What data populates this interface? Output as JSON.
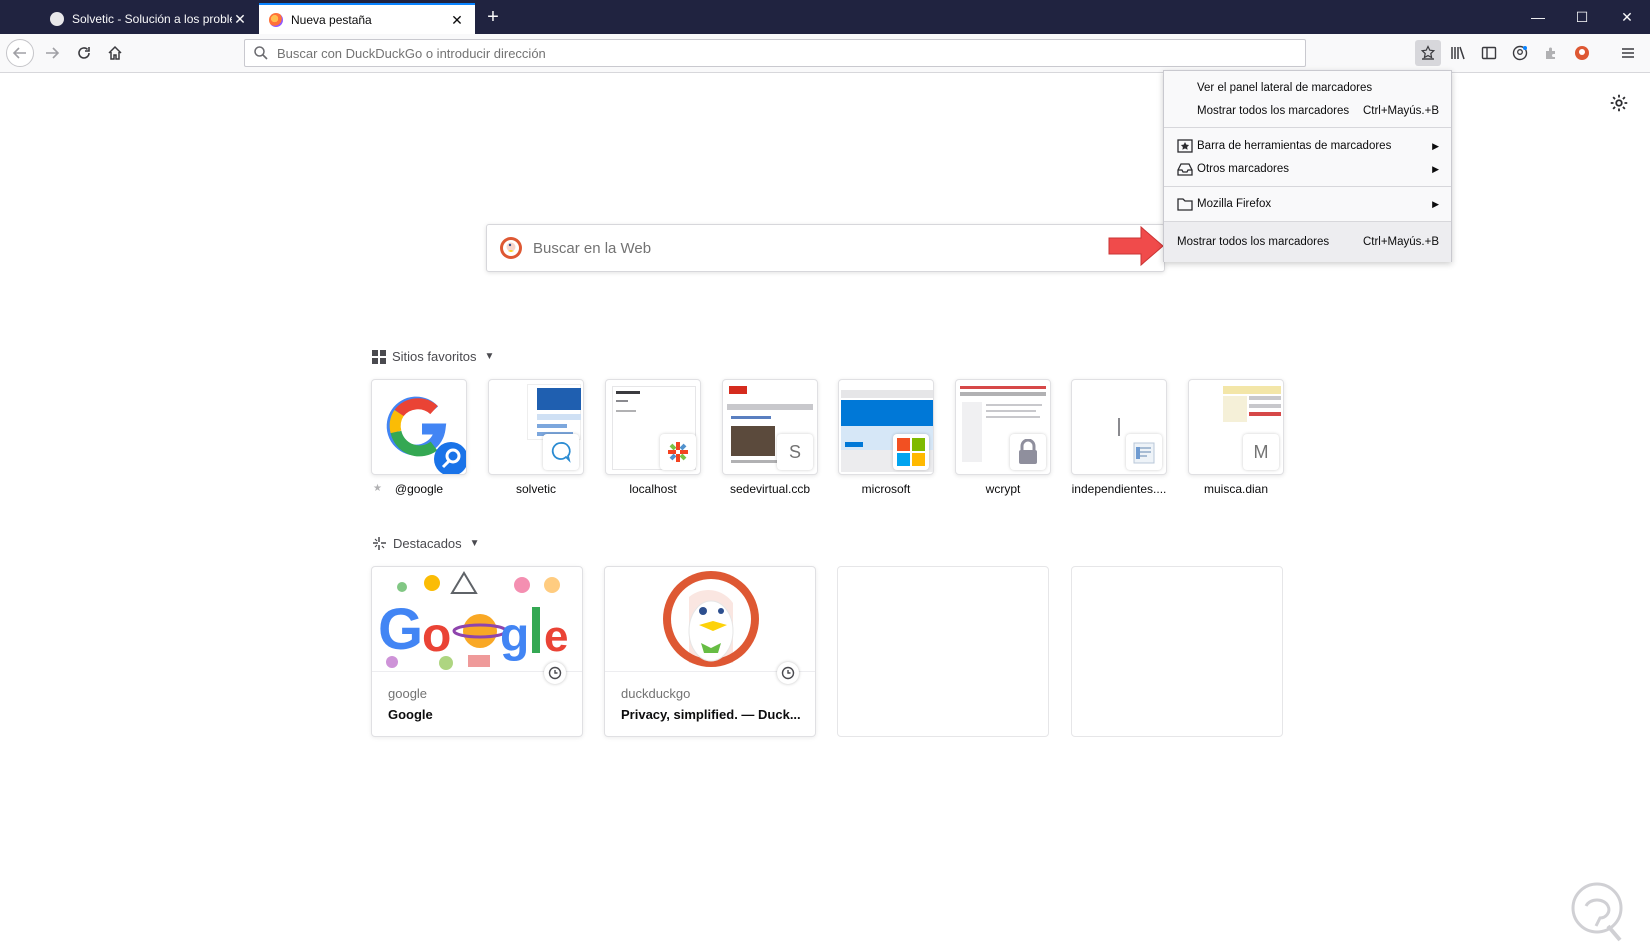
{
  "tabs": [
    {
      "title": "Solvetic - Solución a los problemas",
      "active": false
    },
    {
      "title": "Nueva pestaña",
      "active": true
    }
  ],
  "tab_close_glyph": "✕",
  "newtab_glyph": "+",
  "window_controls": {
    "minimize": "—",
    "maximize": "☐",
    "close": "✕"
  },
  "urlbar": {
    "placeholder": "Buscar con DuckDuckGo o introducir dirección"
  },
  "search": {
    "placeholder": "Buscar en la Web"
  },
  "sections": {
    "topsites_title": "Sitios favoritos",
    "highlights_title": "Destacados"
  },
  "topsites": [
    {
      "label": "@google",
      "pinned": true
    },
    {
      "label": "solvetic"
    },
    {
      "label": "localhost"
    },
    {
      "label": "sedevirtual.ccb"
    },
    {
      "label": "microsoft"
    },
    {
      "label": "wcrypt"
    },
    {
      "label": "independientes...."
    },
    {
      "label": "muisca.dian"
    }
  ],
  "topsite_badges": {
    "sedevirtual": "S",
    "muisca": "M"
  },
  "highlights": [
    {
      "host": "google",
      "title": "Google"
    },
    {
      "host": "duckduckgo",
      "title": "Privacy, simplified. — Duck..."
    }
  ],
  "bookmarks_menu": {
    "items": [
      {
        "label": "Ver el panel lateral de marcadores",
        "shortcut": ""
      },
      {
        "label": "Mostrar todos los marcadores",
        "shortcut": "Ctrl+Mayús.+B"
      },
      {
        "label": "Barra de herramientas de marcadores",
        "submenu": true
      },
      {
        "label": "Otros marcadores",
        "submenu": true
      },
      {
        "label": "Mozilla Firefox",
        "submenu": true
      }
    ],
    "footer": {
      "label": "Mostrar todos los marcadores",
      "shortcut": "Ctrl+Mayús.+B"
    }
  },
  "colors": {
    "tabbar": "#202340",
    "accent": "#0a84ff",
    "annotation_arrow": "#f04b4b",
    "ddg_orange": "#de5833"
  }
}
